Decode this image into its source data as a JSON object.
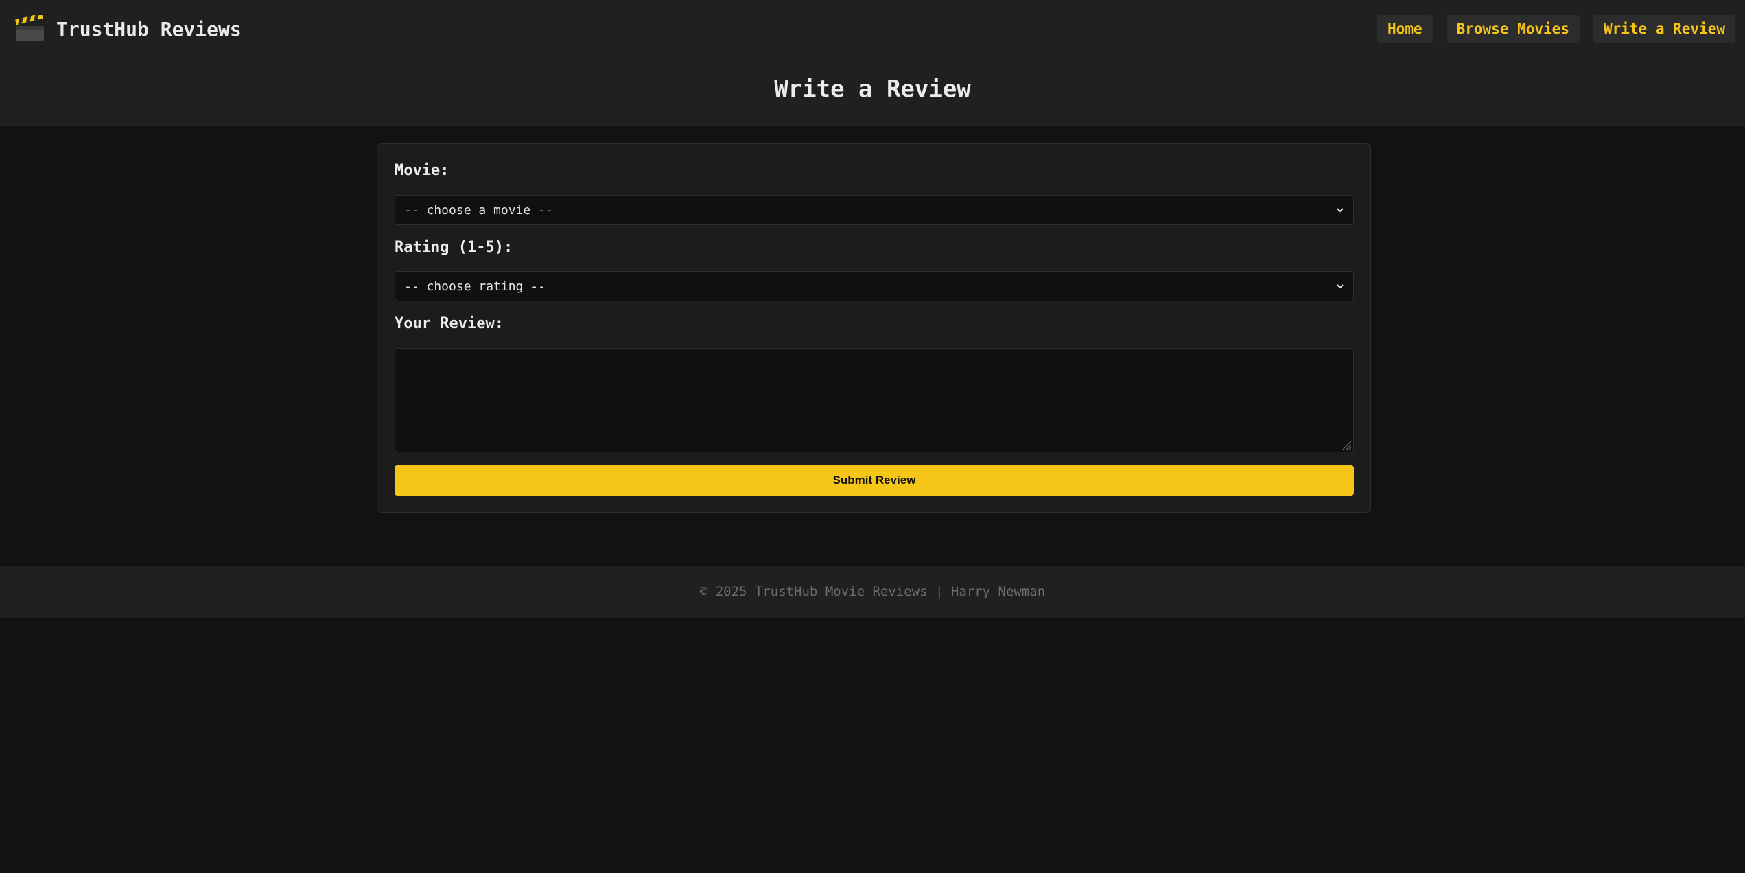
{
  "header": {
    "logo_icon": "clapperboard-icon",
    "brand": "TrustHub Reviews",
    "nav": [
      {
        "label": "Home"
      },
      {
        "label": "Browse Movies"
      },
      {
        "label": "Write a Review"
      }
    ],
    "title": "Write a Review"
  },
  "form": {
    "movie_label": "Movie:",
    "movie_selected": "-- choose a movie --",
    "rating_label": "Rating (1-5):",
    "rating_selected": "-- choose rating --",
    "review_label": "Your Review:",
    "review_value": "",
    "submit_label": "Submit Review"
  },
  "footer": {
    "text": "© 2025 TrustHub Movie Reviews | Harry Newman"
  },
  "colors": {
    "accent": "#f5c518",
    "background": "#121212",
    "header_bg": "#202020",
    "card_bg": "#1c1c1c",
    "input_bg": "#101010"
  }
}
